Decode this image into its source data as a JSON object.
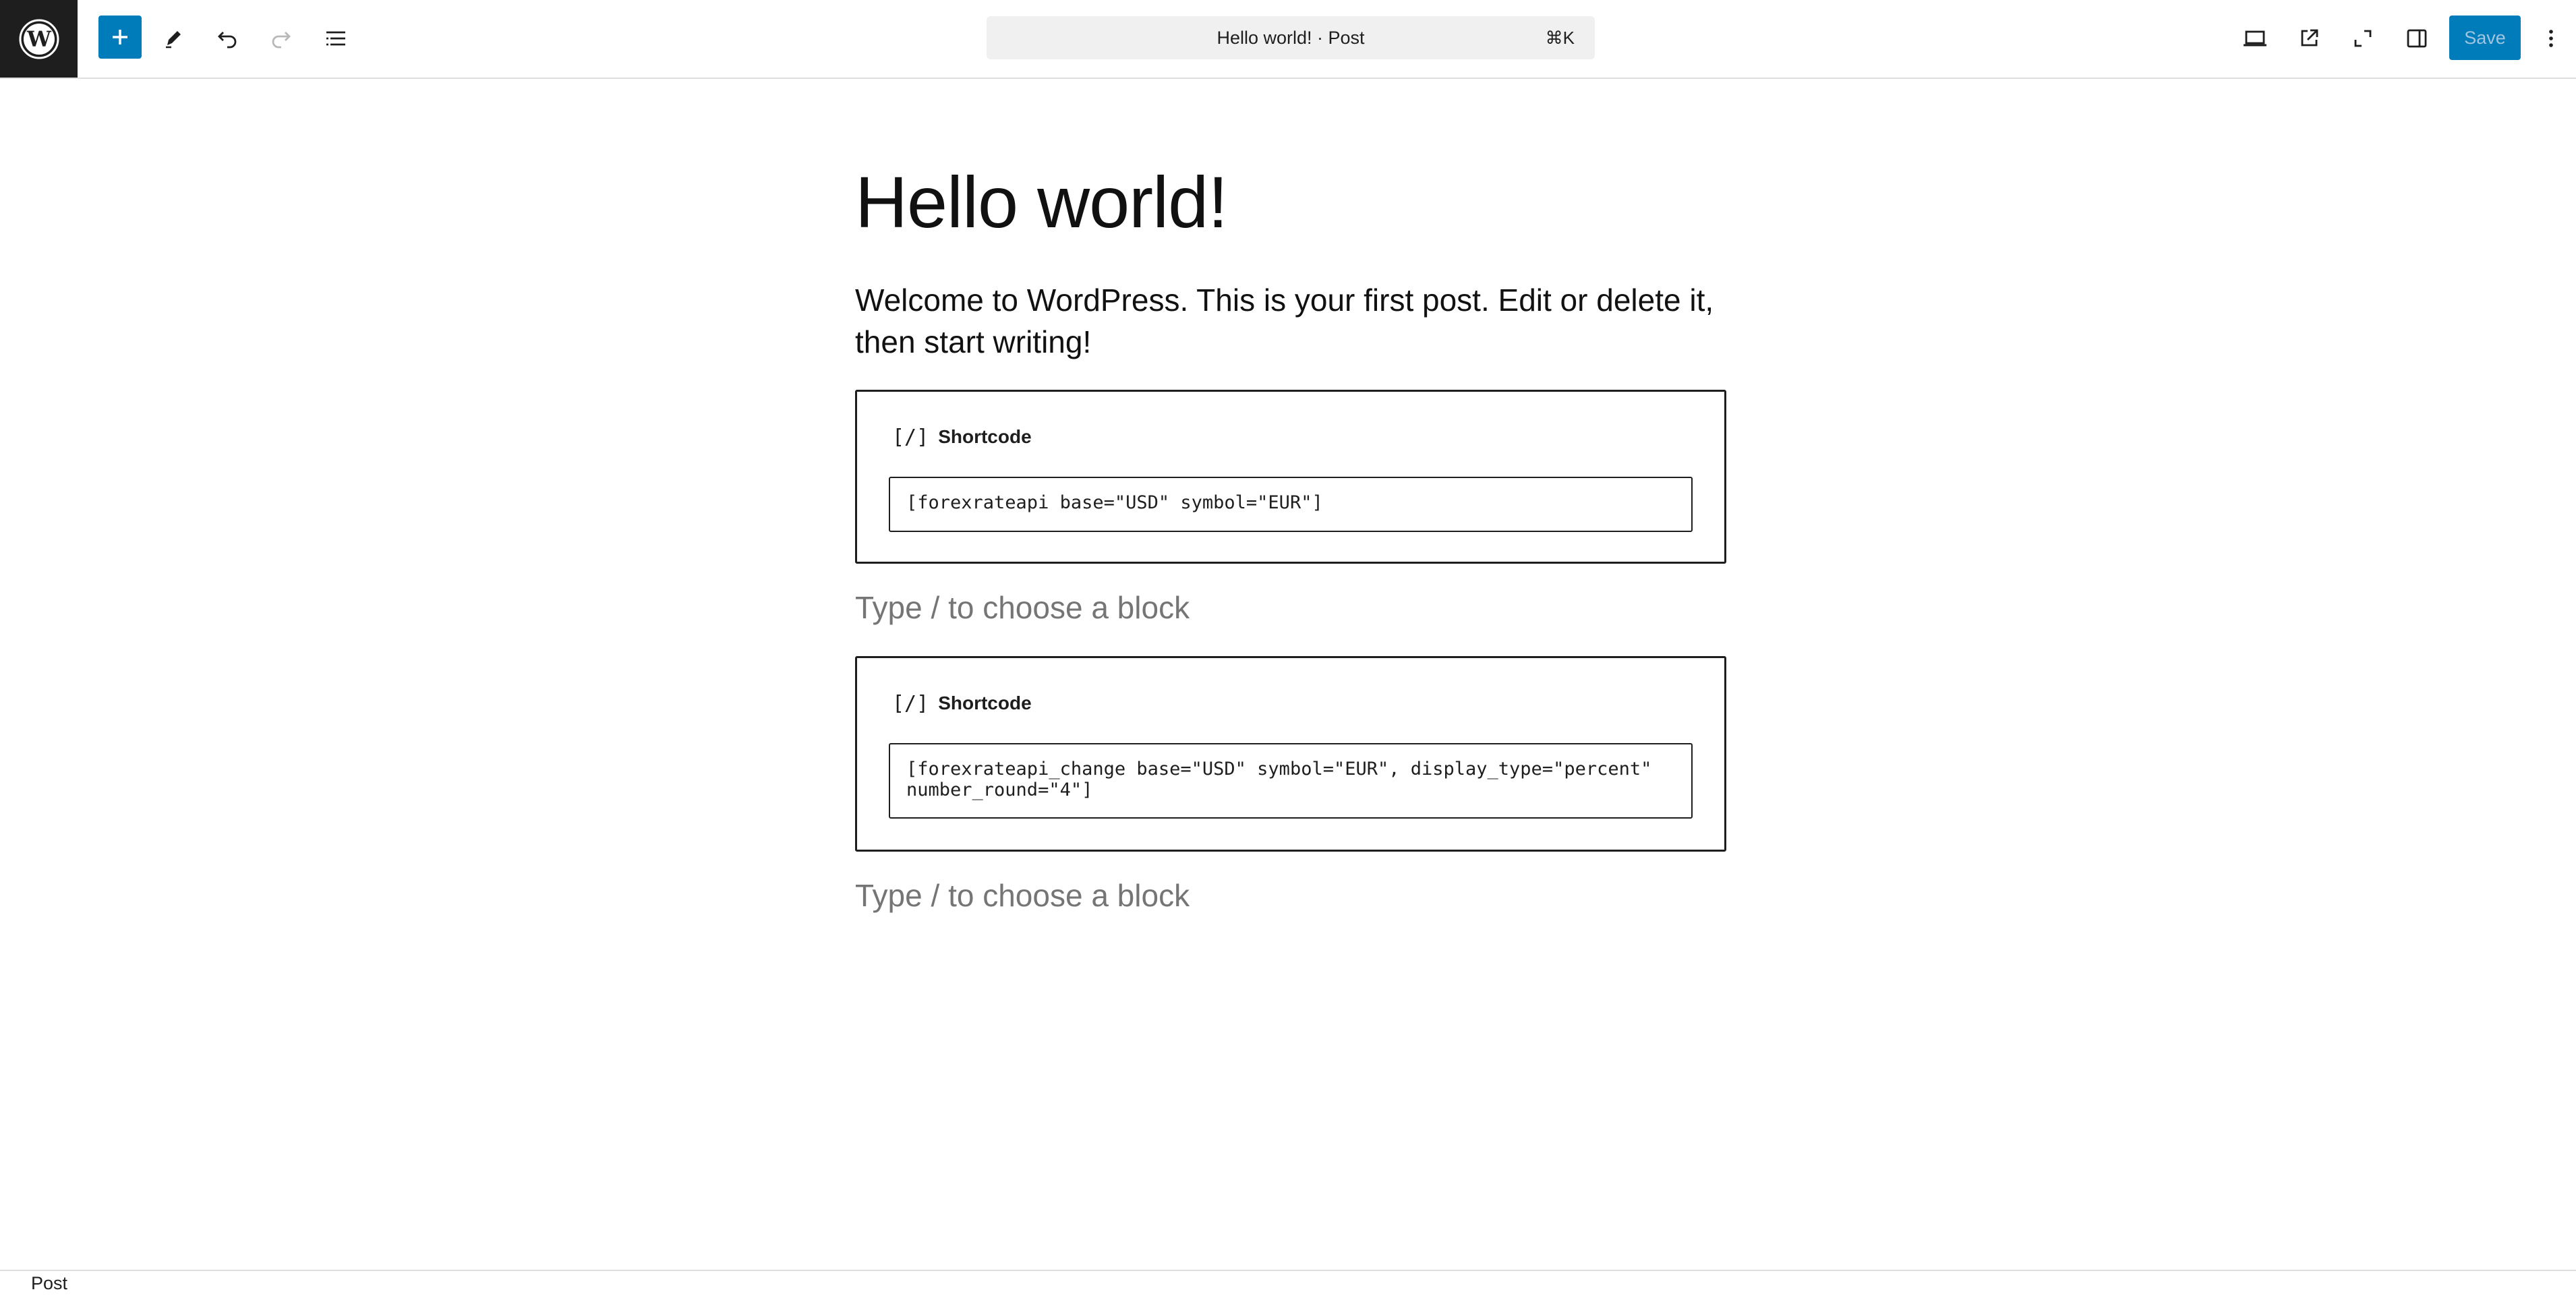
{
  "toolbar": {
    "logo_icon": "wordpress-logo",
    "add_block_icon": "plus-icon",
    "tools_icon": "pencil-icon",
    "undo_icon": "undo-icon",
    "redo_icon": "redo-icon",
    "outline_icon": "list-view-icon",
    "document_title": "Hello world! · Post",
    "command_shortcut": "⌘K",
    "preview_icon": "laptop-icon",
    "view_post_icon": "external-link-icon",
    "fullscreen_icon": "fullscreen-icon",
    "settings_icon": "sidebar-icon",
    "save_label": "Save",
    "options_icon": "more-vertical-icon",
    "accent_color": "#007cba"
  },
  "post": {
    "title": "Hello world!",
    "intro": "Welcome to WordPress. This is your first post. Edit or delete it, then start writing!",
    "blocks": [
      {
        "type_icon": "[/]",
        "label": "Shortcode",
        "value": "[forexrateapi base=\"USD\" symbol=\"EUR\"]"
      },
      {
        "type_icon": "[/]",
        "label": "Shortcode",
        "value": "[forexrateapi_change base=\"USD\" symbol=\"EUR\", display_type=\"percent\" number_round=\"4\"]"
      }
    ],
    "placeholder": "Type / to choose a block"
  },
  "footer": {
    "breadcrumb": "Post"
  }
}
